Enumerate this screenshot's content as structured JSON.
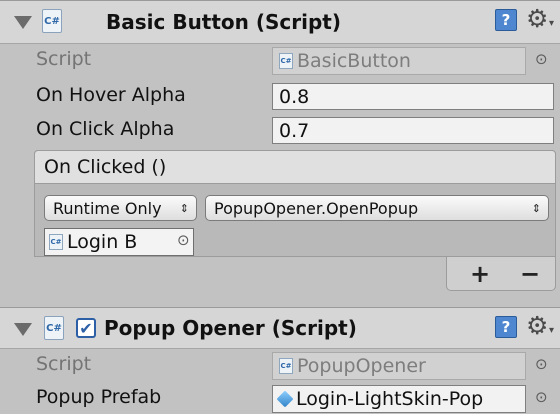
{
  "components": [
    {
      "title": "Basic Button (Script)",
      "script_label": "Script",
      "script_value": "BasicButton",
      "fields": [
        {
          "label": "On Hover Alpha",
          "value": "0.8"
        },
        {
          "label": "On Click Alpha",
          "value": "0.7"
        }
      ],
      "event": {
        "title": "On Clicked ()",
        "runtime_option": "Runtime Only",
        "function": "PopupOpener.OpenPopup",
        "target": "Login B",
        "add_label": "+",
        "remove_label": "−"
      }
    },
    {
      "title": "Popup Opener (Script)",
      "enabled": true,
      "script_label": "Script",
      "script_value": "PopupOpener",
      "prefab_label": "Popup Prefab",
      "prefab_value": "Login-LightSkin-Pop"
    }
  ],
  "icons": {
    "cs_badge": "C#",
    "help": "?",
    "gear": "⚙",
    "gear_caret": "▾",
    "picker": "⊙",
    "popup_arrows": "⇕",
    "check": "✔"
  },
  "colors": {
    "background": "#c2c2c2",
    "header": "#d6d6d6",
    "accent": "#2c5fa6"
  }
}
